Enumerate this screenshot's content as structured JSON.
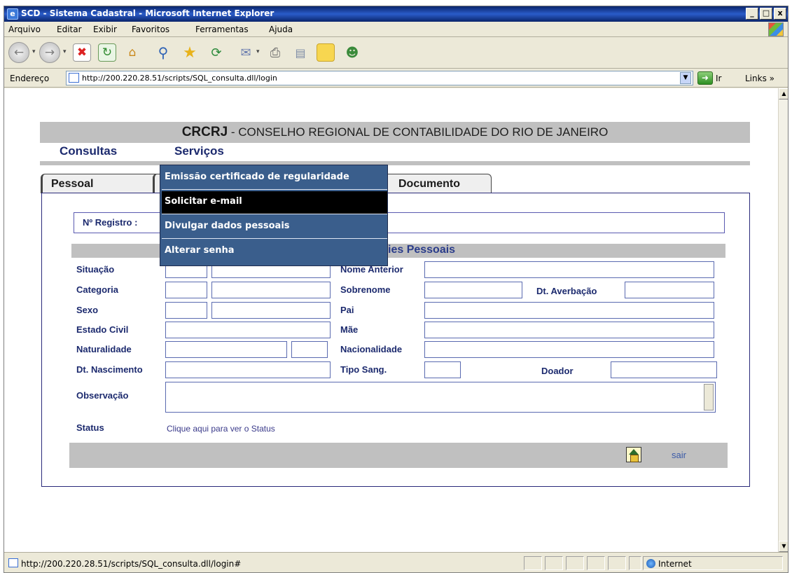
{
  "window": {
    "title": "SCD - Sistema Cadastral - Microsoft Internet Explorer",
    "app_icon": "ie-icon",
    "controls": [
      "_",
      "□",
      "x"
    ]
  },
  "menubar": {
    "items": [
      "Arquivo",
      "Editar",
      "Exibir",
      "Favoritos",
      "Ferramentas",
      "Ajuda"
    ]
  },
  "toolbar": {
    "icons": [
      "back-icon",
      "forward-icon",
      "stop-icon",
      "refresh-icon",
      "home-icon",
      "search-icon",
      "favorites-icon",
      "history-icon",
      "mail-icon",
      "print-icon",
      "edit-icon",
      "folder-icon",
      "messenger-icon"
    ]
  },
  "address": {
    "label": "Endereço",
    "url": "http://200.220.28.51/scripts/SQL_consulta.dll/login",
    "go_label": "Ir",
    "links_label": "Links »"
  },
  "page": {
    "header_brand": "CRCRJ",
    "header_rest": " - CONSELHO REGIONAL DE CONTABILIDADE DO RIO DE JANEIRO",
    "nav": [
      "Consultas",
      "Serviços"
    ],
    "tabs": [
      "Pessoal",
      "Documento"
    ],
    "registro_label": "Nº Registro :",
    "section_title": "ies Pessoais",
    "fields": {
      "situacao": "Situação",
      "categoria": "Categoria",
      "sexo": "Sexo",
      "estado_civil": "Estado Civil",
      "naturalidade": "Naturalidade",
      "dt_nascimento": "Dt. Nascimento",
      "observacao": "Observação",
      "status": "Status",
      "nome_anterior": "Nome Anterior",
      "sobrenome": "Sobrenome",
      "dt_averbacao": "Dt. Averbação",
      "pai": "Pai",
      "mae": "Mãe",
      "nacionalidade": "Nacionalidade",
      "tipo_sang": "Tipo Sang.",
      "doador": "Doador"
    },
    "status_link": "Clique aqui para ver o Status",
    "sair": "sair"
  },
  "services_menu": {
    "items": [
      "Emissão certificado de regularidade",
      "Solicitar e-mail",
      "Divulgar dados pessoais",
      "Alterar senha"
    ],
    "active_index": 1
  },
  "statusbar": {
    "text": "http://200.220.28.51/scripts/SQL_consulta.dll/login#",
    "zone": "Internet"
  },
  "colors": {
    "menu_bg": "#3a5e8c",
    "menu_active": "#000000",
    "label_color": "#1c2a6e",
    "header_gray": "#c0c0c0"
  }
}
